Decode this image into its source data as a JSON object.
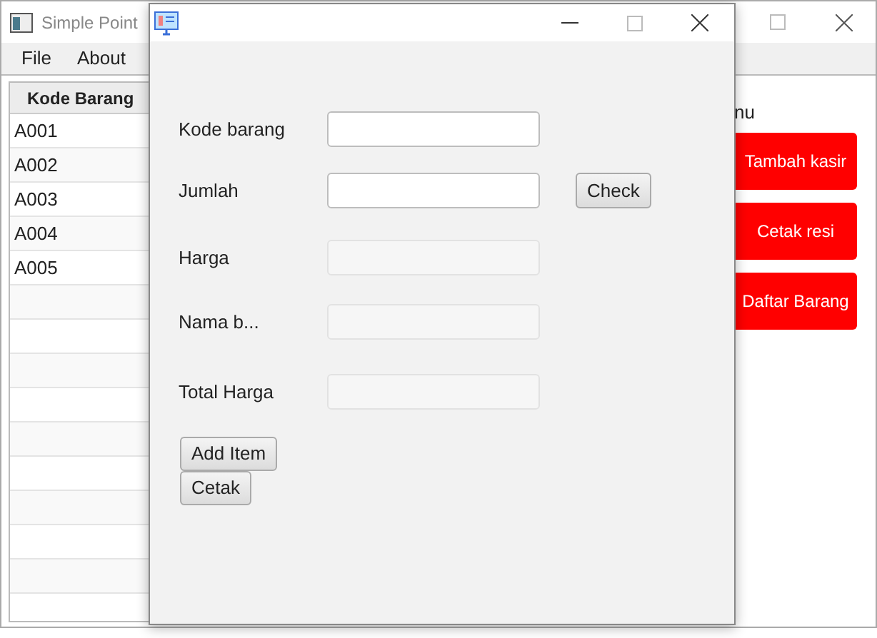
{
  "main_window": {
    "title": "Simple Point",
    "menu": [
      "File",
      "About"
    ],
    "table": {
      "columns": [
        "Kode Barang"
      ],
      "rows": [
        "A001",
        "A002",
        "A003",
        "A004",
        "A005"
      ]
    },
    "menu_label": "nu",
    "menu_buttons": [
      "Tambah kasir",
      "Cetak resi",
      "Daftar Barang"
    ]
  },
  "dialog": {
    "fields": [
      {
        "label": "Kode barang",
        "disabled": false
      },
      {
        "label": "Jumlah",
        "disabled": false,
        "button": "Check"
      },
      {
        "label": "Harga",
        "disabled": true
      },
      {
        "label": "Nama b...",
        "disabled": true
      },
      {
        "label": "Total Harga",
        "disabled": true
      }
    ],
    "buttons": [
      "Add Item",
      "Cetak"
    ]
  }
}
